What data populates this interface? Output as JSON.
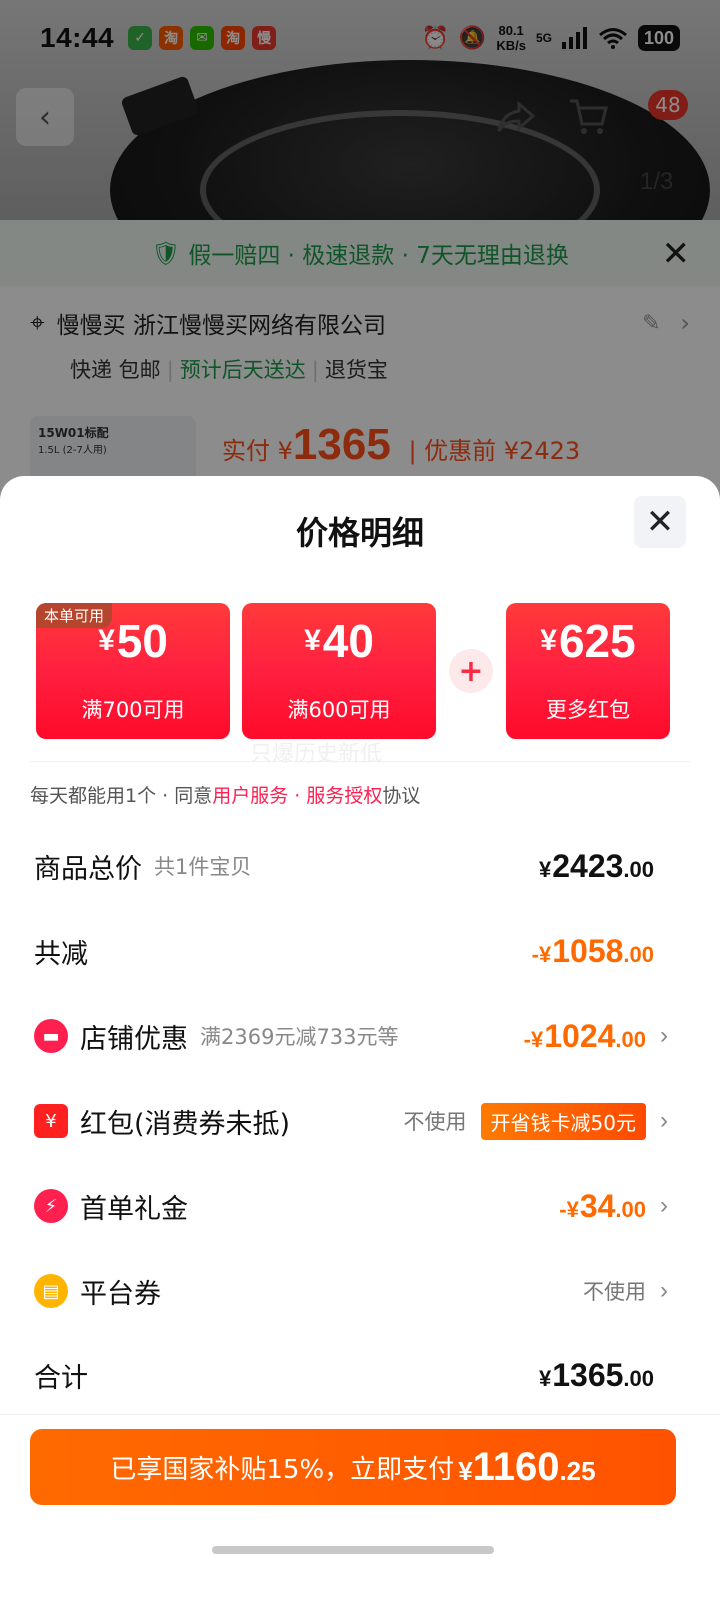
{
  "status_bar": {
    "time": "14:44",
    "net_speed_value": "80.1",
    "net_speed_unit": "KB/s",
    "signal": "5G",
    "battery": "100"
  },
  "background": {
    "cart_count": "48",
    "image_index": "1/3",
    "guarantee_text": "假一赔四 · 极速退款 · 7天无理由退换",
    "address_name": "慢慢买 浙江慢慢买网络有限公司",
    "delivery_express": "快递 包邮",
    "delivery_eta": "预计后天送达",
    "delivery_return": "退货宝",
    "product_thumb_text": "15W01标配",
    "product_thumb_sub": "1.5L (2-7人用)",
    "pay_prefix": "实付 ¥",
    "pay_amount": "1365",
    "pre_discount": "| 优惠前 ¥2423"
  },
  "sheet": {
    "title": "价格明细",
    "coupons": [
      {
        "tag": "本单可用",
        "yen": "¥",
        "amount": "50",
        "condition": "满700可用"
      },
      {
        "tag": "",
        "yen": "¥",
        "amount": "40",
        "condition": "满600可用"
      },
      {
        "tag": "",
        "yen": "¥",
        "amount": "625",
        "condition": "更多红包"
      }
    ],
    "watermark": "只爆历史新低",
    "agreement": {
      "prefix": "每天都能用1个 · 同意",
      "link1": "用户服务",
      "middle": " · ",
      "link2": "服务授权",
      "suffix": "协议"
    },
    "rows": {
      "total": {
        "label": "商品总价",
        "sub": "共1件宝贝",
        "yen": "¥",
        "int": "2423",
        "cents": ".00"
      },
      "discount": {
        "label": "共减",
        "yen": "-¥",
        "int": "1058",
        "cents": ".00"
      },
      "shop": {
        "label": "店铺优惠",
        "sub": "满2369元减733元等",
        "yen": "-¥",
        "int": "1024",
        "cents": ".00"
      },
      "redpacket": {
        "label": "红包(消费券未抵)",
        "unused": "不使用",
        "promo": "开省钱卡减50元"
      },
      "firstorder": {
        "label": "首单礼金",
        "yen": "-¥",
        "int": "34",
        "cents": ".00"
      },
      "platform": {
        "label": "平台券",
        "unused": "不使用"
      },
      "sum": {
        "label": "合计",
        "yen": "¥",
        "int": "1365",
        "cents": ".00"
      }
    },
    "pay_button": {
      "text": "已享国家补贴15%，立即支付",
      "yen": "¥",
      "int": "1160",
      "cents": ".25"
    }
  },
  "colors": {
    "accent_orange": "#ff6a00",
    "coupon_red": "#ff2040",
    "guarantee_green": "#1e9c4b"
  }
}
